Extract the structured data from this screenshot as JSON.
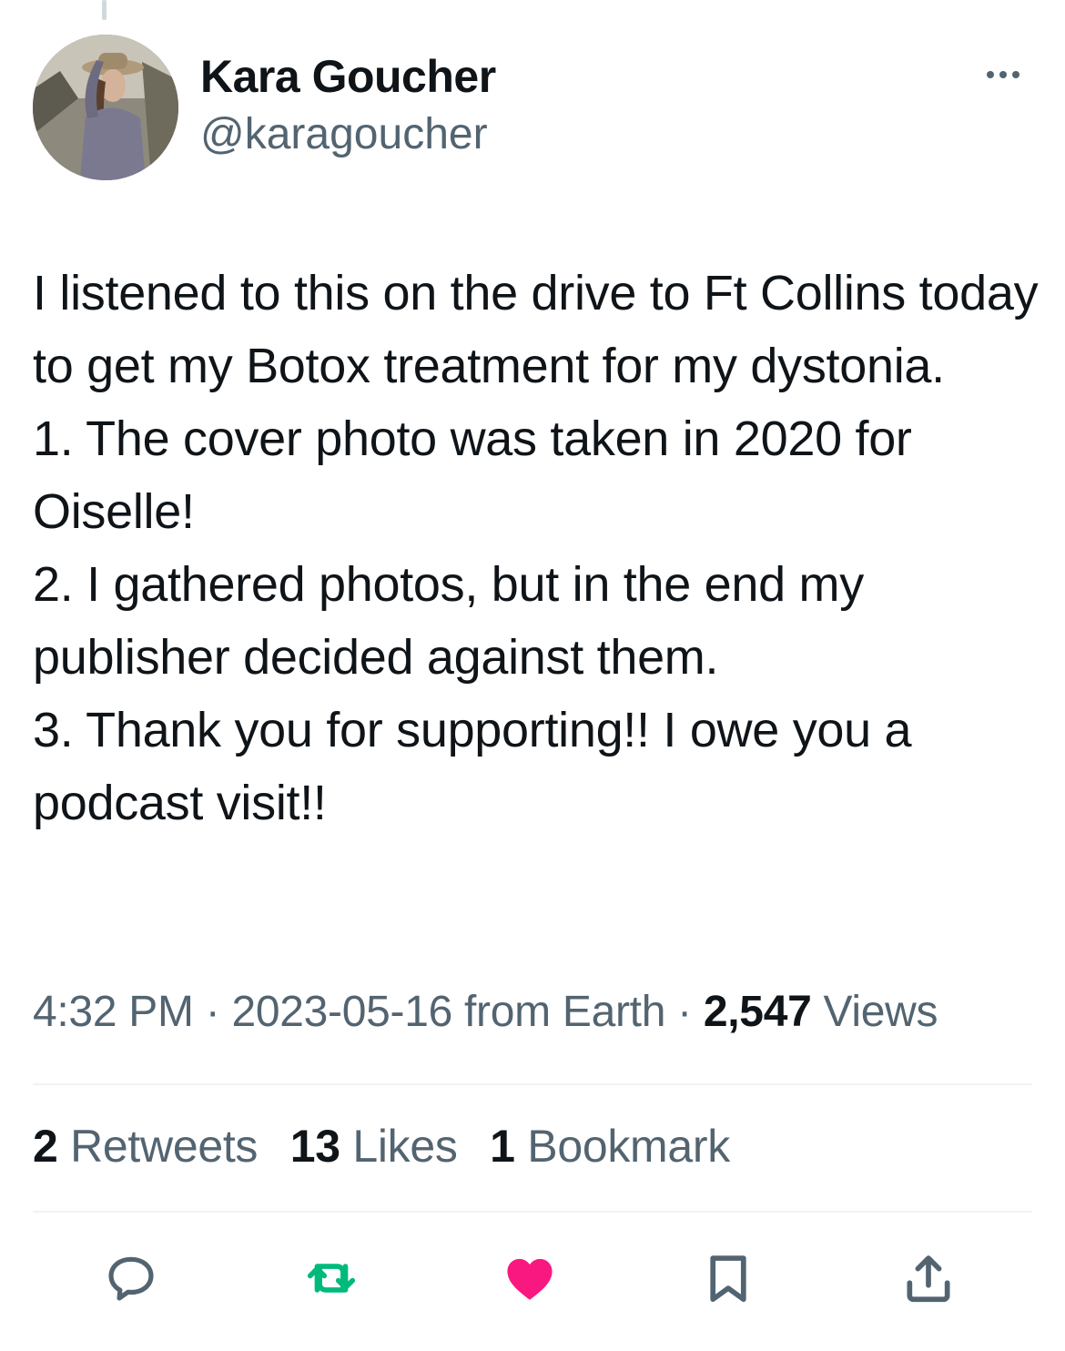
{
  "author": {
    "name": "Kara Goucher",
    "handle": "@karagoucher",
    "avatar_icon": "profile-photo"
  },
  "menu_icon": "more-options-icon",
  "tweet": {
    "text": "I listened to this on the drive to Ft Collins today to get my Botox treatment for my dystonia.\n1. The cover photo was taken in 2020 for Oiselle!\n2. I gathered photos, but in the end my publisher decided against them.\n3. Thank you for supporting!! I owe you a podcast visit!!"
  },
  "meta": {
    "time": "4:32 PM",
    "separator": "·",
    "date_location": "2023-05-16 from Earth",
    "views_count": "2,547",
    "views_label": "Views"
  },
  "stats": {
    "retweets_count": "2",
    "retweets_label": "Retweets",
    "likes_count": "13",
    "likes_label": "Likes",
    "bookmarks_count": "1",
    "bookmarks_label": "Bookmark"
  },
  "actions": {
    "reply_icon": "reply-icon",
    "retweet_icon": "retweet-icon",
    "like_icon": "heart-icon",
    "bookmark_icon": "bookmark-icon",
    "share_icon": "share-icon",
    "colors": {
      "default": "#536471",
      "retweeted": "#00ba7c",
      "liked": "#f91880"
    }
  }
}
